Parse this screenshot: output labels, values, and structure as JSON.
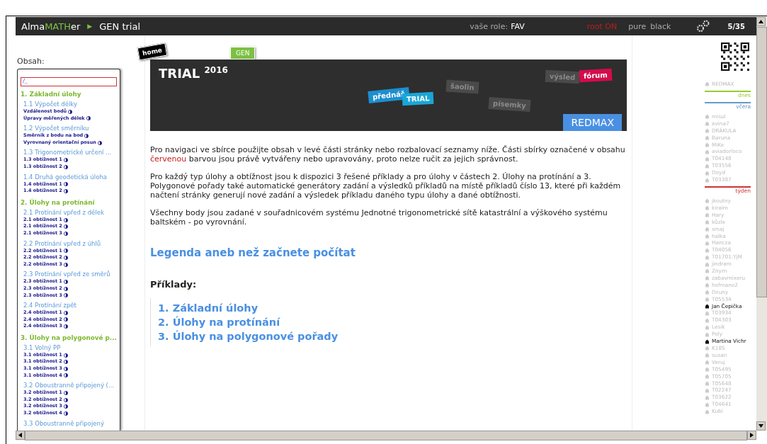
{
  "top_bar": {
    "logo": {
      "prefix": "Alma",
      "highlight": "MATH",
      "suffix": "er"
    },
    "separator": "▶",
    "title": "GEN trial",
    "role_label": "vaše role:",
    "role": "FAV",
    "root": "root ON",
    "themes": [
      "pure",
      "black"
    ],
    "counter": "5/35"
  },
  "tags": [
    {
      "label": "home",
      "kind": "home"
    },
    {
      "label": "GEN",
      "kind": "gen"
    }
  ],
  "banner": {
    "title": "TRIAL $^{2016}$",
    "tags": [
      {
        "label": "přednáš",
        "color": "#1c8fd0"
      },
      {
        "label": "šaolin",
        "color": "#4a4a4a"
      },
      {
        "label": "písemky",
        "color": "#4a4a4a"
      },
      {
        "label": "výsled",
        "color": "#4a4a4a"
      },
      {
        "label": "TRIAL",
        "color": "#1aa6d6"
      },
      {
        "label": "fórum",
        "color": "#d40c4c"
      }
    ],
    "badge": "REDMAX"
  },
  "sidebar": {
    "label": "Obsah:",
    "filter": {
      "value": "/.."
    },
    "sections": [
      {
        "title": "1. Základní úlohy",
        "subsections": [
          {
            "title": "1.1 Výpočet délky",
            "tasks": [
              "Vzdálenost bodů",
              "Úpravy měřených délek"
            ]
          },
          {
            "title": "1.2 Výpočet směrníku",
            "tasks": [
              "Směrník z bodu na bod",
              "Vyrovnaný orientační posun"
            ]
          },
          {
            "title": "1.3 Trigonometrické určení ...",
            "tasks": [
              "1.3 obtížnost 1",
              "1.3 obtížnost 2"
            ]
          },
          {
            "title": "1.4 Druhá geodetická úloha",
            "tasks": [
              "1.4 obtížnost 1",
              "1.4 obtížnost 2"
            ]
          }
        ]
      },
      {
        "title": "2. Úlohy na protínání",
        "subsections": [
          {
            "title": "2.1 Protínání vpřed z délek",
            "tasks": [
              "2.1 obtížnost 1",
              "2.1 obtížnost 2",
              "2.1 obtížnost 3"
            ]
          },
          {
            "title": "2.2 Protínání vpřed z úhlů",
            "tasks": [
              "2.2 obtížnost 1",
              "2.2 obtížnost 2",
              "2.2 obtížnost 3"
            ]
          },
          {
            "title": "2.3 Protínání vpřed ze směrů",
            "tasks": [
              "2.3 obtížnost 1",
              "2.3 obtížnost 2",
              "2.3 obtížnost 3"
            ]
          },
          {
            "title": "2.4 Protínání zpět",
            "tasks": [
              "2.4 obtížnost 1",
              "2.4 obtížnost 2",
              "2.4 obtížnost 3"
            ]
          }
        ]
      },
      {
        "title": "3. Úlohy na polygonové p...",
        "subsections": [
          {
            "title": "3.1 Volný PP",
            "tasks": [
              "3.1 obtížnost 1",
              "3.1 obtížnost 2",
              "3.1 obtížnost 3",
              "3.1 obtížnost 4"
            ]
          },
          {
            "title": "3.2 Oboustranně připojený (...",
            "tasks": [
              "3.2 obtížnost 1",
              "3.2 obtížnost 2",
              "3.2 obtížnost 3",
              "3.2 obtížnost 4"
            ]
          },
          {
            "title": "3.3 Oboustranně připojený"
          }
        ]
      }
    ]
  },
  "content": {
    "paragraphs": [
      [
        {
          "text": "Pro navigaci ve sbírce použijte obsah v levé části stránky nebo rozbalovací seznamy níže. Části sbírky označené v obsahu ",
          "highlight": false
        },
        {
          "text": "červenou",
          "highlight": true
        },
        {
          "text": " barvou jsou právě vytvářeny nebo upravovány, proto nelze ručit za jejich správnost.",
          "highlight": false
        }
      ],
      [
        {
          "text": "Pro každý typ úlohy a obtížnost jsou k dispozici 3 řešené příklady a pro úlohy v částech 2. Úlohy na protínání a 3. Polygonové pořady také automatické generátory zadání a výsledků příkladů na místě příkladů číslo 13, které při každém načtení stránky generují nové zadání a výsledek příkladu daného typu úlohy a dané obtížnosti.",
          "highlight": false
        }
      ],
      [
        {
          "text": "Všechny body jsou zadané v souřadnicovém systému Jednotné trigonometrické sítě katastrální a výškového systému baltském - po vyrovnání.",
          "highlight": false
        }
      ]
    ],
    "legend_link": "Legenda aneb než začnete počítat",
    "examples_heading": "Příklady:",
    "examples": [
      "1. Základní úlohy",
      "2. Úlohy na protínání",
      "3. Úlohy na polygonové pořady"
    ]
  },
  "users": {
    "groups": [
      {
        "users": [
          {
            "name": "REDMAX",
            "online": false
          }
        ],
        "label": "dnes",
        "color": "#99cc33"
      },
      {
        "label": "včera",
        "color": "#6699cc"
      },
      {
        "users": [
          {
            "name": "misul",
            "online": false
          },
          {
            "name": "evina7",
            "online": false
          },
          {
            "name": "DRÁKULA",
            "online": false
          },
          {
            "name": "Baruna",
            "online": false
          },
          {
            "name": "MiKe",
            "online": false
          },
          {
            "name": "aviadorloco",
            "online": false
          },
          {
            "name": "T04148",
            "online": false
          },
          {
            "name": "T03556",
            "online": false
          },
          {
            "name": "Doyd",
            "online": false
          },
          {
            "name": "T03387",
            "online": false
          }
        ],
        "label": "týden",
        "color": "#cc3333"
      },
      {
        "users": [
          {
            "name": "jkoutny",
            "online": false
          },
          {
            "name": "kiralm",
            "online": false
          },
          {
            "name": "Hary",
            "online": false
          },
          {
            "name": "kůzle",
            "online": false
          },
          {
            "name": "smaj",
            "online": false
          },
          {
            "name": "halka",
            "online": false
          },
          {
            "name": "Hancza",
            "online": false
          },
          {
            "name": "T04056",
            "online": false
          },
          {
            "name": "T01701:YjM",
            "online": false
          },
          {
            "name": "jindram",
            "online": false
          },
          {
            "name": "Znyrn",
            "online": false
          },
          {
            "name": "zabavmixeru",
            "online": false
          },
          {
            "name": "hofmano2",
            "online": false
          },
          {
            "name": "Dzuny",
            "online": false
          },
          {
            "name": "T05534",
            "online": false
          },
          {
            "name": "Jan Čepička",
            "online": true
          },
          {
            "name": "T03934",
            "online": false
          },
          {
            "name": "T04303",
            "online": false
          },
          {
            "name": "Lesik",
            "online": false
          },
          {
            "name": "Poly",
            "online": false
          },
          {
            "name": "Martina Vichr",
            "online": true
          },
          {
            "name": "K18S",
            "online": false
          },
          {
            "name": "susan",
            "online": false
          },
          {
            "name": "Veruj",
            "online": false
          },
          {
            "name": "T05495",
            "online": false
          },
          {
            "name": "T05705",
            "online": false
          },
          {
            "name": "T05648",
            "online": false
          },
          {
            "name": "T02247",
            "online": false
          },
          {
            "name": "T03622",
            "online": false
          },
          {
            "name": "T04641",
            "online": false
          },
          {
            "name": "Kubi",
            "online": false
          }
        ]
      }
    ]
  }
}
